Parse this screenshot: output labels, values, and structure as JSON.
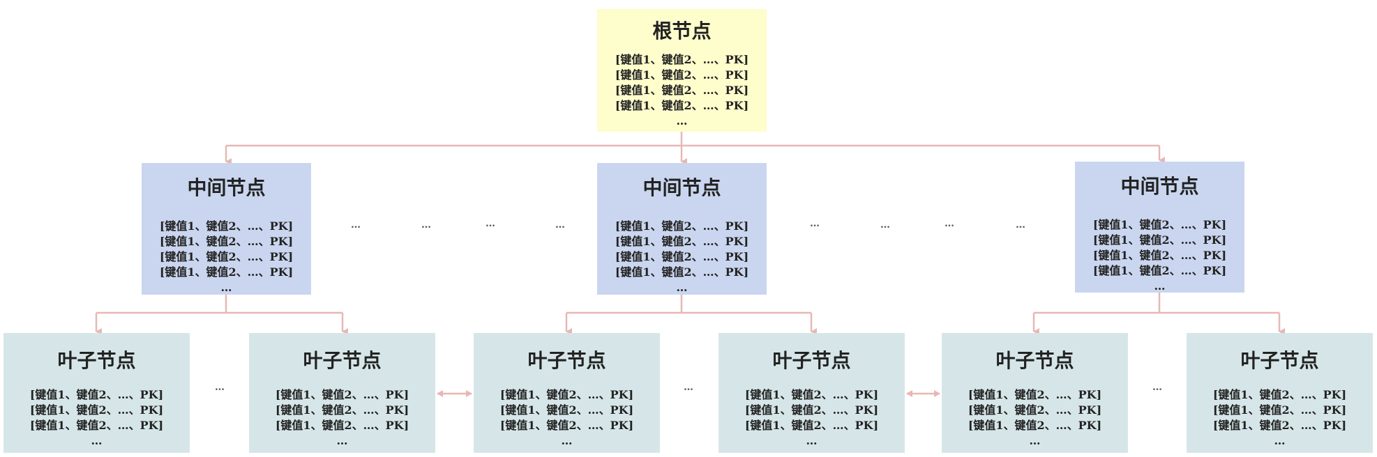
{
  "colors": {
    "root": "#fefdcc",
    "intermediate": "#cad6ef",
    "leaf": "#d6e6e8",
    "connector": "#e6b8b4"
  },
  "root": {
    "title": "根节点",
    "rows": [
      "[键值1、键值2、…、PK]",
      "[键值1、键值2、…、PK]",
      "[键值1、键值2、…、PK]",
      "[键值1、键值2、…、PK]",
      "…"
    ]
  },
  "intermediate": [
    {
      "title": "中间节点",
      "rows": [
        "[键值1、键值2、…、PK]",
        "[键值1、键值2、…、PK]",
        "[键值1、键值2、…、PK]",
        "[键值1、键值2、…、PK]",
        "…"
      ]
    },
    {
      "title": "中间节点",
      "rows": [
        "[键值1、键值2、…、PK]",
        "[键值1、键值2、…、PK]",
        "[键值1、键值2、…、PK]",
        "[键值1、键值2、…、PK]",
        "…"
      ]
    },
    {
      "title": "中间节点",
      "rows": [
        "[键值1、键值2、…、PK]",
        "[键值1、键值2、…、PK]",
        "[键值1、键值2、…、PK]",
        "[键值1、键值2、…、PK]",
        "…"
      ]
    }
  ],
  "leaves": [
    {
      "title": "叶子节点",
      "rows": [
        "[键值1、键值2、…、PK]",
        "[键值1、键值2、…、PK]",
        "[键值1、键值2、…、PK]",
        "…"
      ]
    },
    {
      "title": "叶子节点",
      "rows": [
        "[键值1、键值2、…、PK]",
        "[键值1、键值2、…、PK]",
        "[键值1、键值2、…、PK]",
        "…"
      ]
    },
    {
      "title": "叶子节点",
      "rows": [
        "[键值1、键值2、…、PK]",
        "[键值1、键值2、…、PK]",
        "[键值1、键值2、…、PK]",
        "…"
      ]
    },
    {
      "title": "叶子节点",
      "rows": [
        "[键值1、键值2、…、PK]",
        "[键值1、键值2、…、PK]",
        "[键值1、键值2、…、PK]",
        "…"
      ]
    },
    {
      "title": "叶子节点",
      "rows": [
        "[键值1、键值2、…、PK]",
        "[键值1、键值2、…、PK]",
        "[键值1、键值2、…、PK]",
        "…"
      ]
    },
    {
      "title": "叶子节点",
      "rows": [
        "[键值1、键值2、…、PK]",
        "[键值1、键值2、…、PK]",
        "[键值1、键值2、…、PK]",
        "…"
      ]
    }
  ],
  "ellipsis": "…"
}
